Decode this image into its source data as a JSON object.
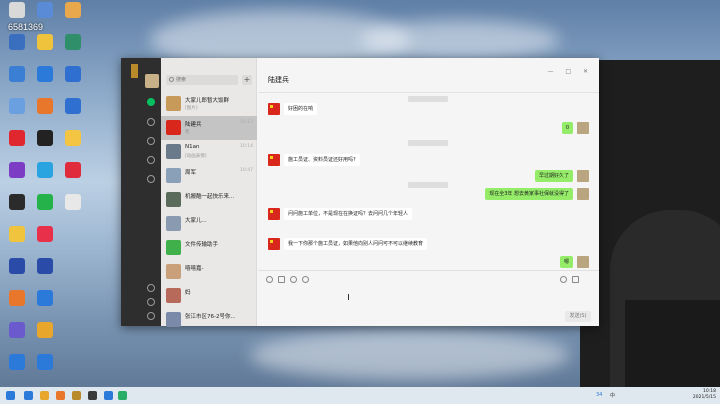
{
  "desktop": {
    "counter": "6581369",
    "icons": [
      {
        "label": "",
        "color": "#d9d9d9",
        "col": 0,
        "row": 0
      },
      {
        "label": "",
        "color": "#5a8bd6",
        "col": 1,
        "row": 0
      },
      {
        "label": "",
        "color": "#e8a84b",
        "col": 2,
        "row": 0
      },
      {
        "label": "",
        "color": "#3a6fbf",
        "col": 0,
        "row": 1
      },
      {
        "label": "",
        "color": "#f0c33c",
        "col": 1,
        "row": 1
      },
      {
        "label": "",
        "color": "#2f8f6a",
        "col": 2,
        "row": 1
      },
      {
        "label": "",
        "color": "#3b7fd4",
        "col": 0,
        "row": 2
      },
      {
        "label": "",
        "color": "#2b7ad9",
        "col": 1,
        "row": 2
      },
      {
        "label": "",
        "color": "#2f6fcf",
        "col": 2,
        "row": 2
      },
      {
        "label": "",
        "color": "#6aa0e0",
        "col": 0,
        "row": 3
      },
      {
        "label": "",
        "color": "#e8762b",
        "col": 1,
        "row": 3
      },
      {
        "label": "",
        "color": "#2f6fcf",
        "col": 2,
        "row": 3
      },
      {
        "label": "",
        "color": "#e0262e",
        "col": 0,
        "row": 4
      },
      {
        "label": "",
        "color": "#222222",
        "col": 1,
        "row": 4
      },
      {
        "label": "",
        "color": "#f4c542",
        "col": 2,
        "row": 4
      },
      {
        "label": "",
        "color": "#7c3cc4",
        "col": 0,
        "row": 5
      },
      {
        "label": "",
        "color": "#2aa4e0",
        "col": 1,
        "row": 5
      },
      {
        "label": "",
        "color": "#e02b3c",
        "col": 2,
        "row": 5
      },
      {
        "label": "",
        "color": "#2b2b2b",
        "col": 0,
        "row": 6
      },
      {
        "label": "",
        "color": "#25b24b",
        "col": 1,
        "row": 6
      },
      {
        "label": "",
        "color": "#e8e8e8",
        "col": 2,
        "row": 6
      },
      {
        "label": "",
        "color": "#f0c43c",
        "col": 0,
        "row": 7
      },
      {
        "label": "",
        "color": "#e8304a",
        "col": 1,
        "row": 7
      },
      {
        "label": "",
        "color": "#2a4ba8",
        "col": 0,
        "row": 8
      },
      {
        "label": "",
        "color": "#2a4ba8",
        "col": 1,
        "row": 8
      },
      {
        "label": "",
        "color": "#e8762b",
        "col": 0,
        "row": 9
      },
      {
        "label": "",
        "color": "#2b7ad9",
        "col": 1,
        "row": 9
      },
      {
        "label": "",
        "color": "#6a5acd",
        "col": 0,
        "row": 10
      },
      {
        "label": "",
        "color": "#e8a62b",
        "col": 1,
        "row": 10
      },
      {
        "label": "",
        "color": "#2b7ad9",
        "col": 0,
        "row": 11
      },
      {
        "label": "",
        "color": "#2b7ad9",
        "col": 1,
        "row": 11
      }
    ]
  },
  "wechat": {
    "search_placeholder": "搜索",
    "add_label": "+",
    "chat_title": "陆建兵",
    "window_controls": "— □ ✕",
    "send_label": "发送(S)",
    "chats": [
      {
        "name": "大家儿郎暂大饭群",
        "preview": "[图片]",
        "time": "",
        "color": "#c79a5a"
      },
      {
        "name": "陆建兵",
        "preview": "嗯",
        "time": "10:17",
        "color": "#d9281b",
        "selected": true
      },
      {
        "name": "N1an",
        "preview": "[动画表情]",
        "time": "10:14",
        "color": "#6b7a8a"
      },
      {
        "name": "周军",
        "preview": "",
        "time": "10:47",
        "color": "#8aa0b8"
      },
      {
        "name": "机搬酷一起快乐来...",
        "preview": "",
        "time": "",
        "color": "#5b6b5b"
      },
      {
        "name": "大家儿...",
        "preview": "",
        "time": "",
        "color": "#8a9ab0"
      },
      {
        "name": "文件传输助手",
        "preview": "",
        "time": "",
        "color": "#3fb04a"
      },
      {
        "name": "嘻嘻嘉-",
        "preview": "",
        "time": "",
        "color": "#c9a07a"
      },
      {
        "name": "妈",
        "preview": "",
        "time": "",
        "color": "#b86a5a"
      },
      {
        "name": "张江市区76-2号你...",
        "preview": "",
        "time": "",
        "color": "#7a8aa8"
      }
    ],
    "messages": [
      {
        "side": "in",
        "text": "好困的在响"
      },
      {
        "side": "out",
        "text": "0"
      },
      {
        "side": "in",
        "text": "施工员证、资料员证还好用吗?"
      },
      {
        "side": "out",
        "text": "早过期好久了"
      },
      {
        "side": "out",
        "text": "现在全3年 想去黄家事社保就没得了"
      },
      {
        "side": "in",
        "text": "问问施工单位，不是现在在换证吗？去问问几个年轻人"
      },
      {
        "side": "in",
        "text": "我一下你那个施工员证，如果他向别人问问可不可以继续教育"
      },
      {
        "side": "out",
        "text": "嗯"
      }
    ]
  },
  "taskbar": {
    "time": "10:18",
    "date": "2021/5/15",
    "lang": "中",
    "badge": "34"
  }
}
